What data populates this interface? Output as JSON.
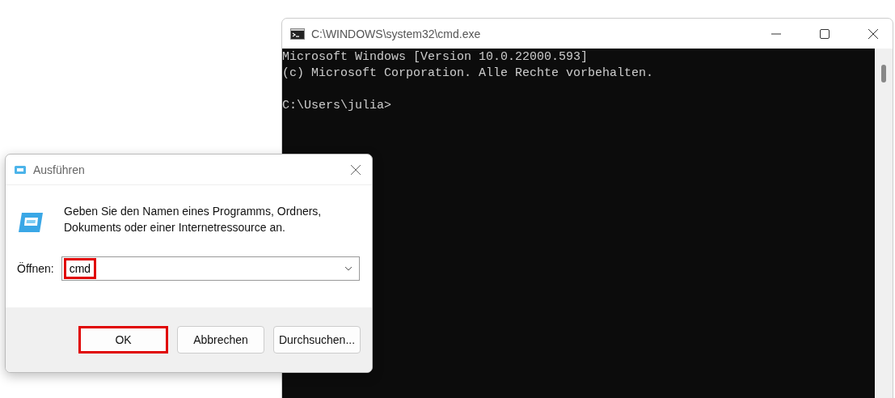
{
  "console_window": {
    "title": "C:\\WINDOWS\\system32\\cmd.exe",
    "output": [
      "Microsoft Windows [Version 10.0.22000.593]",
      "(c) Microsoft Corporation. Alle Rechte vorbehalten."
    ],
    "prompt": "C:\\Users\\julia>"
  },
  "run_dialog": {
    "title": "Ausführen",
    "description": "Geben Sie den Namen eines Programms, Ordners, Dokuments oder einer Internetressource an.",
    "open_field": {
      "label": "Öffnen:",
      "value": "cmd",
      "highlighted": true
    },
    "buttons": [
      {
        "label": "OK",
        "highlighted": true
      },
      {
        "label": "Abbrechen",
        "highlighted": false
      },
      {
        "label": "Durchsuchen...",
        "highlighted": false
      }
    ]
  }
}
